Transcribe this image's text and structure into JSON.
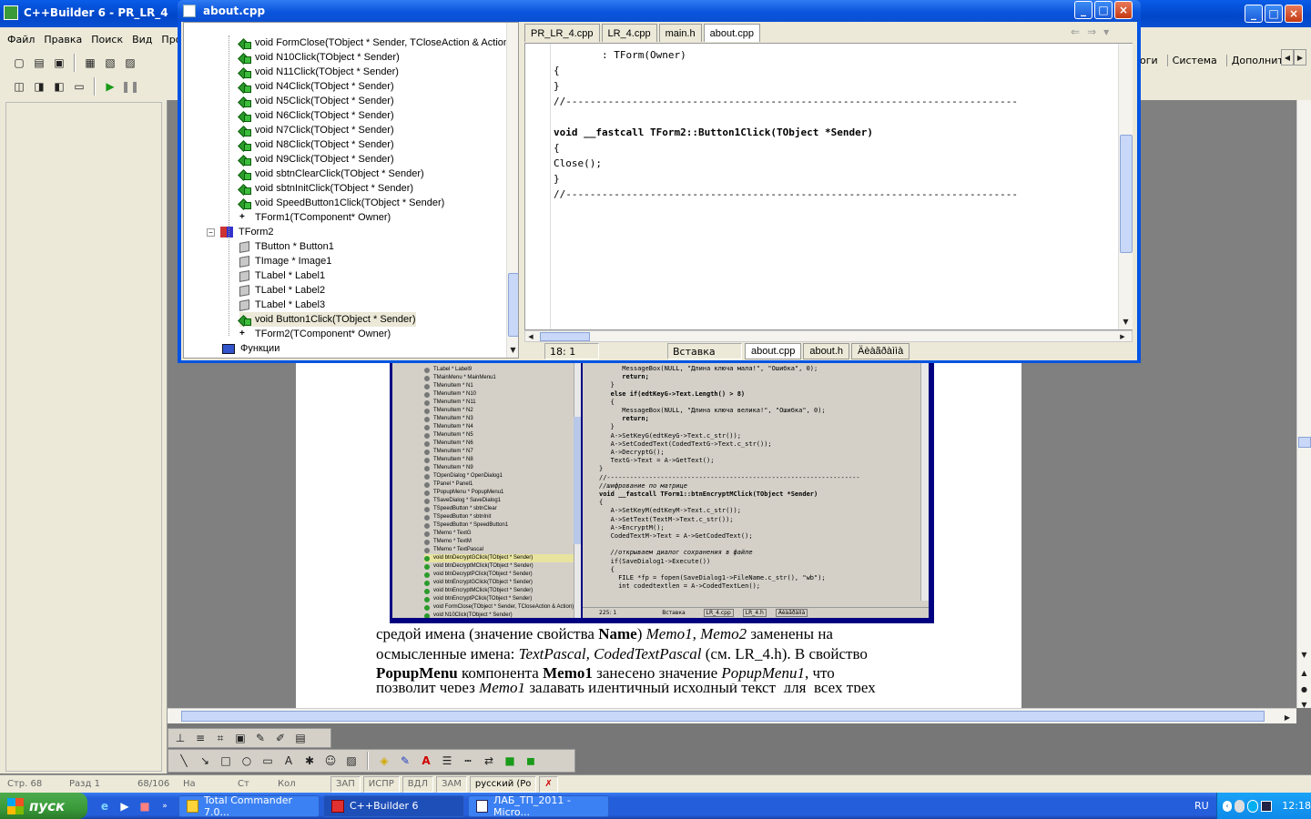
{
  "cbuilder": {
    "title": "C++Builder 6 - PR_LR_4",
    "menu": [
      "Файл",
      "Правка",
      "Поиск",
      "Вид",
      "Про"
    ],
    "palette_tabs": [
      "оги",
      "Система",
      "Дополнител"
    ],
    "status": {
      "line": "Стр. 68",
      "section": "Разд 1",
      "pages": "68/106"
    }
  },
  "editor": {
    "title": "about.cpp",
    "tabs": [
      "PR_LR_4.cpp",
      "LR_4.cpp",
      "main.h",
      "about.cpp"
    ],
    "tree": {
      "form1_methods": [
        "void FormClose(TObject * Sender, TCloseAction & Action)",
        "void N10Click(TObject * Sender)",
        "void N11Click(TObject * Sender)",
        "void N4Click(TObject * Sender)",
        "void N5Click(TObject * Sender)",
        "void N6Click(TObject * Sender)",
        "void N7Click(TObject * Sender)",
        "void N8Click(TObject * Sender)",
        "void N9Click(TObject * Sender)",
        "void sbtnClearClick(TObject * Sender)",
        "void sbtnInitClick(TObject * Sender)",
        "void SpeedButton1Click(TObject * Sender)"
      ],
      "form1_ctor": "TForm1(TComponent* Owner)",
      "form2": "TForm2",
      "form2_fields": [
        "TButton * Button1",
        "TImage * Image1",
        "TLabel * Label1",
        "TLabel * Label2",
        "TLabel * Label3"
      ],
      "form2_method": "void Button1Click(TObject * Sender)",
      "form2_ctor": "TForm2(TComponent* Owner)",
      "functions": "Функции"
    },
    "code": [
      "        : TForm(Owner)",
      "{",
      "}",
      "//---------------------------------------------------------------------------",
      "",
      "void __fastcall TForm2::Button1Click(TObject *Sender)",
      "{",
      "Close();",
      "}",
      "//---------------------------------------------------------------------------"
    ],
    "status": {
      "pos": "18:   1",
      "mode": "Вставка"
    },
    "bottom_tabs": [
      "about.cpp",
      "about.h",
      "Äèàãðàììà"
    ]
  },
  "document": {
    "paragraph_lines": [
      [
        "средой имена (значение свойства ",
        "Name",
        ") ",
        "Memo1, Memo2",
        " заменены на"
      ],
      [
        "осмысленные имена: ",
        "",
        "",
        "TextPascal, CodedTextPascal",
        " (см. LR_4.h). В свойство"
      ],
      [
        "",
        "PopupMenu",
        " компонента ",
        "",
        ""
      ],
      [
        "позволит через ",
        "",
        "",
        "Memo1",
        " задавать идентичный исходный текст  для  всех трех"
      ]
    ],
    "line3_bold2": "Memo1",
    "line3_rest": " занесено значение ",
    "line3_ital": "PopupMenu1",
    "line3_end": ", что",
    "word_status": [
      "На",
      "Ст",
      "Кол",
      "ЗАП",
      "ИСПР",
      "ВДЛ",
      "ЗАМ",
      "русский (Ро"
    ]
  },
  "screenshot": {
    "tree_items": [
      "TLabel * Label9",
      "TMainMenu * MainMenu1",
      "TMenuItem * N1",
      "TMenuItem * N10",
      "TMenuItem * N11",
      "TMenuItem * N2",
      "TMenuItem * N3",
      "TMenuItem * N4",
      "TMenuItem * N5",
      "TMenuItem * N6",
      "TMenuItem * N7",
      "TMenuItem * N8",
      "TMenuItem * N9",
      "TOpenDialog * OpenDialog1",
      "TPanel * Panel1",
      "TPopupMenu * PopupMenu1",
      "TSaveDialog * SaveDialog1",
      "TSpeedButton * sbtnClear",
      "TSpeedButton * sbtnInit",
      "TSpeedButton * SpeedButton1",
      "TMemo * TextG",
      "TMemo * TextM",
      "TMemo * TextPascal",
      "void btnDecryptGClick(TObject * Sender)",
      "void btnDecryptMClick(TObject * Sender)",
      "void btnDecryptPClick(TObject * Sender)",
      "void btnEncryptGClick(TObject * Sender)",
      "void btnEncryptMClick(TObject * Sender)",
      "void btnEncryptPClick(TObject * Sender)",
      "void FormClose(TObject * Sender, TCloseAction & Action)",
      "void N10Click(TObject * Sender)"
    ],
    "code": [
      "      MessageBox(NULL, \"Длина ключа мала!\", \"Ошибка\", 0);",
      "      return;",
      "   }",
      "   else if(edtKeyG->Text.Length() > 8)",
      "   {",
      "      MessageBox(NULL, \"Длина ключа велика!\", \"Ошибка\", 0);",
      "      return;",
      "   }",
      "   A->SetKeyG(edtKeyG->Text.c_str());",
      "   A->SetCodedText(CodedTextG->Text.c_str());",
      "   A->DecryptG();",
      "   TextG->Text = A->GetText();",
      "}",
      "//------------------------------------------------------------------",
      "//шифрование по матрице",
      "void __fastcall TForm1::btnEncryptMClick(TObject *Sender)",
      "{",
      "   A->SetKeyM(edtKeyM->Text.c_str());",
      "   A->SetText(TextM->Text.c_str());",
      "   A->EncryptM();",
      "   CodedTextM->Text = A->GetCodedText();",
      "",
      "   //открываем диалог сохранения в файле",
      "   if(SaveDialog1->Execute())",
      "   {",
      "     FILE *fp = fopen(SaveDialog1->FileName.c_str(), \"wb\");",
      "     int codedtextlen = A->CodedTextLen();"
    ],
    "status_pos": "225:  1",
    "status_mode": "Вставка",
    "tabs": [
      "LR_4.cpp",
      "LR_4.h",
      "Äèàãðàììà"
    ]
  },
  "taskbar": {
    "start": "пуск",
    "tasks": [
      "Total Commander 7.0...",
      "C++Builder 6",
      "ЛАБ_ТП_2011 - Micro..."
    ],
    "lang": "RU",
    "time": "12:18"
  },
  "colors": {
    "xp_blue": "#0054e3",
    "taskbar": "#245edb",
    "start": "#3a9a3a",
    "tray": "#0f8ae9"
  }
}
